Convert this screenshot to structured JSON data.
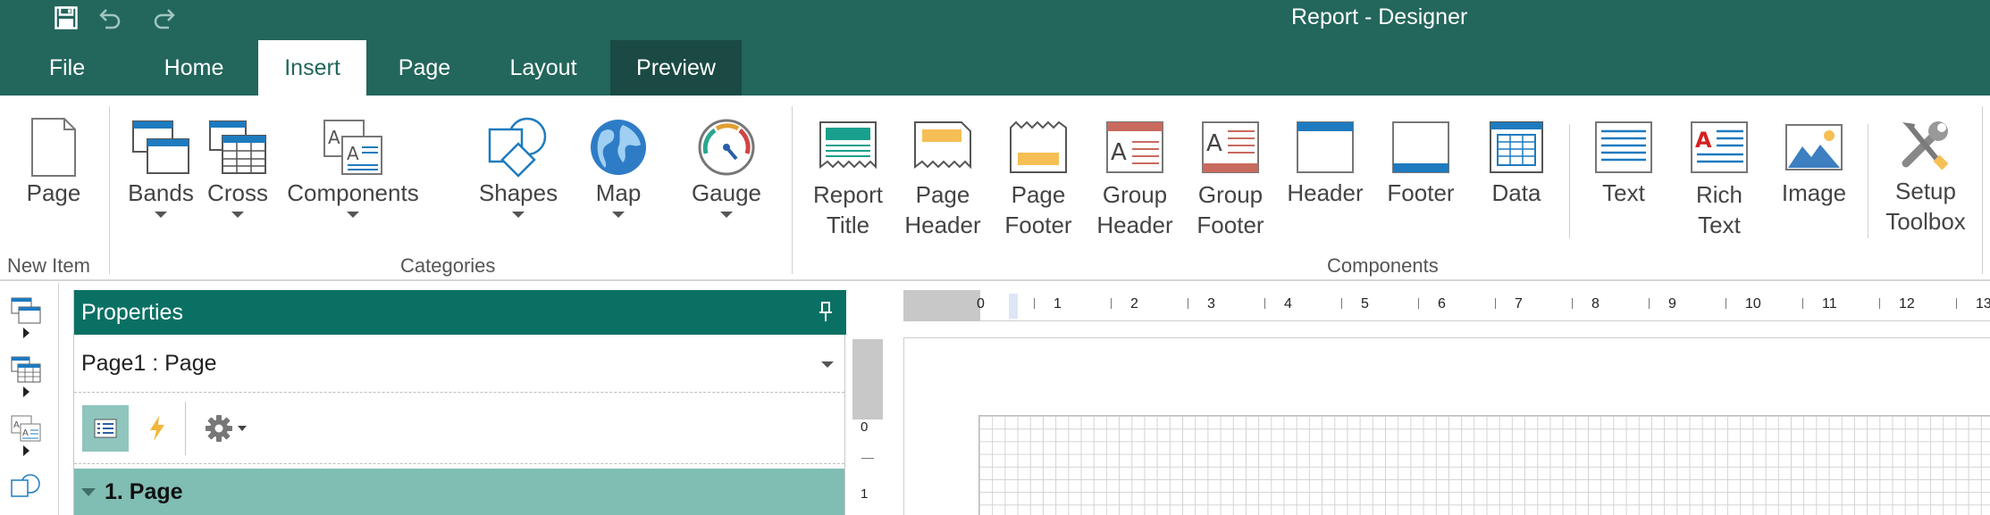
{
  "app": {
    "title": "Report - Designer"
  },
  "quick_access": {
    "save_icon": "save-icon",
    "undo_icon": "undo-icon",
    "redo_icon": "redo-icon"
  },
  "tabs": [
    {
      "label": "File"
    },
    {
      "label": "Home"
    },
    {
      "label": "Insert",
      "active": true
    },
    {
      "label": "Page"
    },
    {
      "label": "Layout"
    },
    {
      "label": "Preview",
      "highlight": true
    }
  ],
  "ribbon": {
    "new_item": {
      "group": "New Item",
      "page": "Page"
    },
    "categories": {
      "group": "Categories",
      "bands": "Bands",
      "cross": "Cross",
      "components": "Components",
      "shapes": "Shapes",
      "map": "Map",
      "gauge": "Gauge"
    },
    "components": {
      "group": "Components",
      "report_title": "Report\nTitle",
      "page_header": "Page\nHeader",
      "page_footer": "Page\nFooter",
      "group_header": "Group\nHeader",
      "group_footer": "Group\nFooter",
      "header": "Header",
      "footer": "Footer",
      "data": "Data",
      "text": "Text",
      "rich_text": "Rich\nText",
      "image": "Image",
      "setup_toolbox": "Setup\nToolbox"
    }
  },
  "properties": {
    "title": "Properties",
    "selected_object": "Page1 : Page",
    "category": "1. Page"
  },
  "ruler": {
    "horizontal": [
      "0",
      "1",
      "2",
      "3",
      "4",
      "5",
      "6",
      "7",
      "8",
      "9",
      "10",
      "11",
      "12",
      "13"
    ],
    "vertical": [
      "0",
      "1"
    ]
  },
  "colors": {
    "titlebar": "#23665c",
    "accent": "#0b7064",
    "category_row": "#80bdb3",
    "preview_tab": "#1a4a43"
  }
}
